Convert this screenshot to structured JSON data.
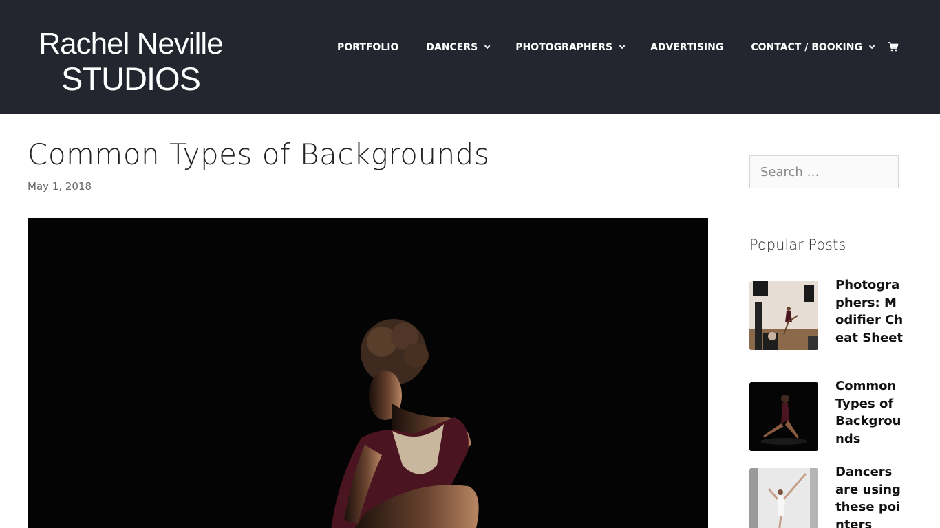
{
  "header": {
    "logo_line1": "Rachel Neville",
    "logo_line2": "STUDIOS",
    "nav": [
      {
        "label": "PORTFOLIO",
        "has_dropdown": false
      },
      {
        "label": "DANCERS",
        "has_dropdown": true
      },
      {
        "label": "PHOTOGRAPHERS",
        "has_dropdown": true
      },
      {
        "label": "ADVERTISING",
        "has_dropdown": false
      },
      {
        "label": "CONTACT / BOOKING",
        "has_dropdown": true
      }
    ],
    "cart_icon": "cart-icon",
    "bg_color": "#23262e"
  },
  "post": {
    "title": "Common Types of Backgrounds",
    "date": "May 1, 2018",
    "image_alt": "dancer in burgundy leotard on black background"
  },
  "sidebar": {
    "search_placeholder": "Search …",
    "popular_title": "Popular Posts",
    "popular_posts": [
      {
        "title": "Photographers: Modifier Cheat Sheet"
      },
      {
        "title": "Common Types of Backgrounds"
      },
      {
        "title": "Dancers are using these pointers"
      }
    ]
  }
}
